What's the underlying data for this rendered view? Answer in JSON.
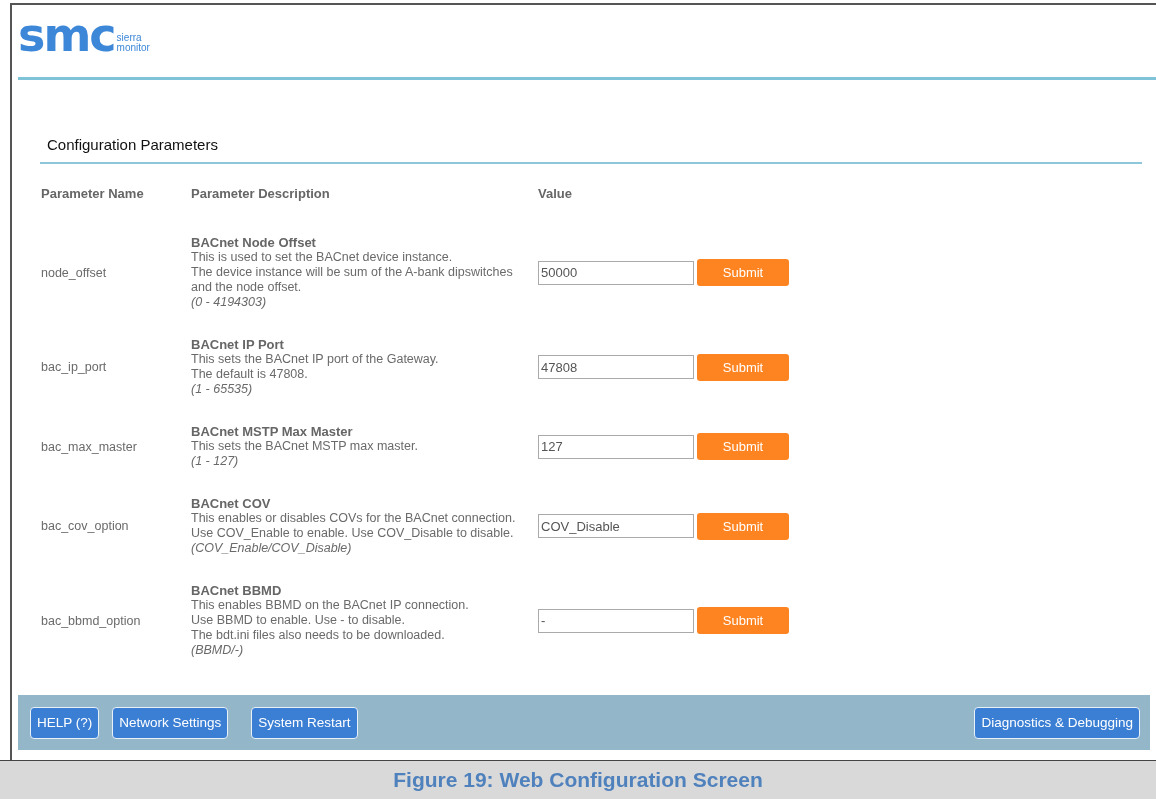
{
  "logo": {
    "mark": "smc",
    "line_1": "sierra",
    "line_2": "monitor"
  },
  "section_title": "Configuration Parameters",
  "table": {
    "columns": [
      "Parameter Name",
      "Parameter Description",
      "Value"
    ],
    "rows": [
      {
        "name": "node_offset",
        "title": "BACnet Node Offset",
        "lines": [
          "This is used to set the BACnet device instance.",
          "The device instance will be sum of the A-bank dipswitches",
          "and the node offset."
        ],
        "range": "(0 - 4194303)",
        "value": "50000",
        "button": "Submit"
      },
      {
        "name": "bac_ip_port",
        "title": "BACnet IP Port",
        "lines": [
          "This sets the BACnet IP port of the Gateway.",
          "The default is 47808."
        ],
        "range": "(1 - 65535)",
        "value": "47808",
        "button": "Submit"
      },
      {
        "name": "bac_max_master",
        "title": "BACnet MSTP Max Master",
        "lines": [
          "This sets the BACnet MSTP max master."
        ],
        "range": "(1 - 127)",
        "value": "127",
        "button": "Submit"
      },
      {
        "name": "bac_cov_option",
        "title": "BACnet COV",
        "lines": [
          "This enables or disables COVs for the BACnet connection.",
          "Use COV_Enable to enable. Use COV_Disable to disable."
        ],
        "range": "(COV_Enable/COV_Disable)",
        "value": "COV_Disable",
        "button": "Submit"
      },
      {
        "name": "bac_bbmd_option",
        "title": "BACnet BBMD",
        "lines": [
          "This enables BBMD on the BACnet IP connection.",
          "Use BBMD to enable. Use - to disable.",
          "The bdt.ini files also needs to be downloaded."
        ],
        "range": "(BBMD/-)",
        "value": "-",
        "button": "Submit"
      }
    ]
  },
  "footer_buttons": {
    "left": [
      "HELP (?)",
      "Network Settings",
      "System Restart"
    ],
    "right": [
      "Diagnostics & Debugging"
    ]
  },
  "caption": "Figure 19: Web Configuration Screen"
}
